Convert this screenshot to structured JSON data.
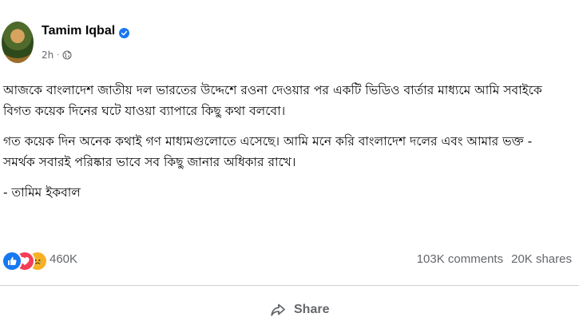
{
  "author": {
    "name": "Tamim Iqbal",
    "verified": true,
    "timestamp": "2h",
    "separator": "·",
    "privacy_icon": "globe-icon"
  },
  "post": {
    "paragraphs": [
      {
        "lines": [
          "আজকে বাংলাদেশ জাতীয় দল ভারতের উদ্দেশে রওনা দেওয়ার পর একটি ভিডিও বার্তার মাধ্যমে আমি সবাইকে",
          "বিগত কয়েক দিনের ঘটে যাওয়া ব্যাপারে কিছু কথা বলবো।"
        ]
      },
      {
        "lines": [
          "গত কয়েক দিন অনেক কথাই গণ মাধ্যমগুলোতে এসেছে। আমি মনে করি বাংলাদেশ দলের এবং আমার ভক্ত -",
          "সমর্থক সবারই পরিষ্কার ভাবে সব কিছু জানার অধিকার রাখে।"
        ]
      },
      {
        "lines": [
          "- তামিম ইকবাল"
        ]
      }
    ]
  },
  "reactions": {
    "icons": [
      "like-icon",
      "love-icon",
      "sad-icon"
    ],
    "count": "460K"
  },
  "engagement": {
    "comments": "103K comments",
    "shares": "20K shares"
  },
  "actions": {
    "share_label": "Share"
  },
  "colors": {
    "verified": "#1877f2",
    "like": "#1877f2",
    "love": "#f33e58",
    "sad": "#f7b125",
    "secondary_text": "#65676b"
  }
}
